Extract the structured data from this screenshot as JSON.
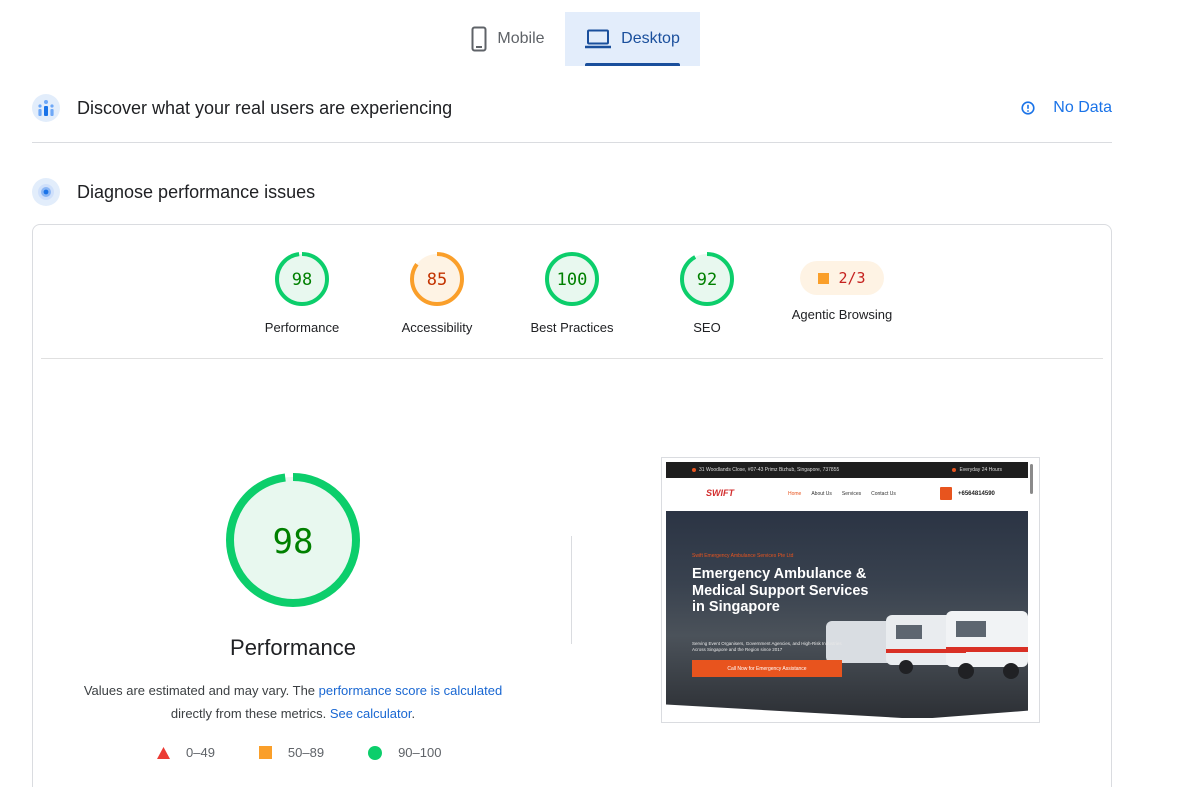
{
  "tabs": {
    "mobile": {
      "label": "Mobile",
      "icon": "phone-icon",
      "selected": false
    },
    "desktop": {
      "label": "Desktop",
      "icon": "laptop-icon",
      "selected": true
    }
  },
  "discover": {
    "title": "Discover what your real users are experiencing",
    "icon": "users-chart-icon",
    "status_label": "No Data",
    "status_icon": "info-icon"
  },
  "diagnose": {
    "title": "Diagnose performance issues",
    "icon": "target-icon"
  },
  "categories": [
    {
      "id": "performance",
      "label": "Performance",
      "score": "98",
      "status": "pass"
    },
    {
      "id": "accessibility",
      "label": "Accessibility",
      "score": "85",
      "status": "average"
    },
    {
      "id": "best-practices",
      "label": "Best Practices",
      "score": "100",
      "status": "pass"
    },
    {
      "id": "seo",
      "label": "SEO",
      "score": "92",
      "status": "pass"
    },
    {
      "id": "agentic-browsing",
      "label": "Agentic Browsing",
      "score": "2/3",
      "status": "average"
    }
  ],
  "performance_detail": {
    "score": "98",
    "title": "Performance",
    "note_prefix": "Values are estimated and may vary. The ",
    "note_link1": "performance score is calculated",
    "note_middle": "directly from these metrics. ",
    "note_link2": "See calculator",
    "note_suffix": "."
  },
  "legend": [
    {
      "range": "0–49",
      "shape": "triangle",
      "color": "#eb3b34"
    },
    {
      "range": "50–89",
      "shape": "square",
      "color": "#fa9f2a"
    },
    {
      "range": "90–100",
      "shape": "circle",
      "color": "#0cce6b"
    }
  ],
  "colors": {
    "pass": "#0cce6b",
    "pass_text": "#008000",
    "pass_bg": "#e8f8ef",
    "average": "#fa9f2a",
    "average_text": "#c33300",
    "average_bg": "#fef3e4",
    "accent": "#1a73e8"
  },
  "screenshot": {
    "topbar_address": "31 Woodlands Close, #07-43 Primz Bizhub, Singapore, 737855",
    "topbar_hours": "Everyday 24 Hours",
    "logo": "SWIFT",
    "nav": [
      "Home",
      "About Us",
      "Services",
      "Contact Us"
    ],
    "phone": "+6564814590",
    "kicker": "Swift Emergency Ambulance Services Pte Ltd",
    "headline": "Emergency Ambulance & Medical Support Services in Singapore",
    "subtext": "Serving Event Organisers, Government Agencies, and High-Risk Industries Across Singapore and the Region since 2017",
    "cta": "Call Now for Emergency Assistance"
  }
}
